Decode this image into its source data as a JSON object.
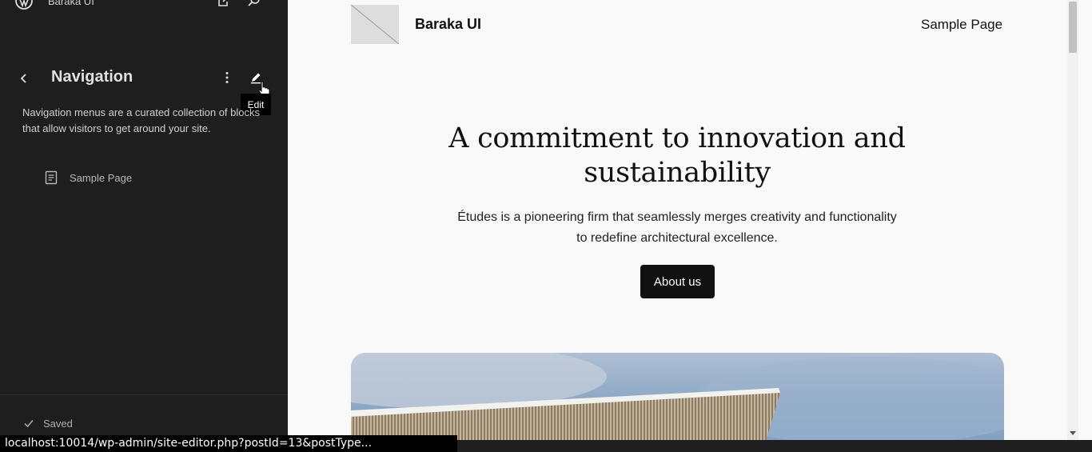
{
  "sidebar": {
    "site_name": "Baraka UI",
    "title": "Navigation",
    "description": "Navigation menus are a curated collection of blocks that allow visitors to get around your site.",
    "tooltip": "Edit",
    "items": [
      {
        "label": "Sample Page",
        "icon": "page-icon"
      }
    ],
    "save_status": "Saved"
  },
  "preview": {
    "site_title": "Baraka UI",
    "menu": [
      "Sample Page"
    ],
    "heading": "A commitment to innovation and sustainability",
    "text": "Études is a pioneering firm that seamlessly merges creativity and functionality to redefine architectural excellence.",
    "button_label": "About us"
  },
  "status_bar": {
    "url": "localhost:10014/wp-admin/site-editor.php?postId=13&postType..."
  },
  "colors": {
    "sidebar_bg": "#1e1e1e",
    "canvas_bg": "#f9f9f9",
    "button_bg": "#111111"
  }
}
